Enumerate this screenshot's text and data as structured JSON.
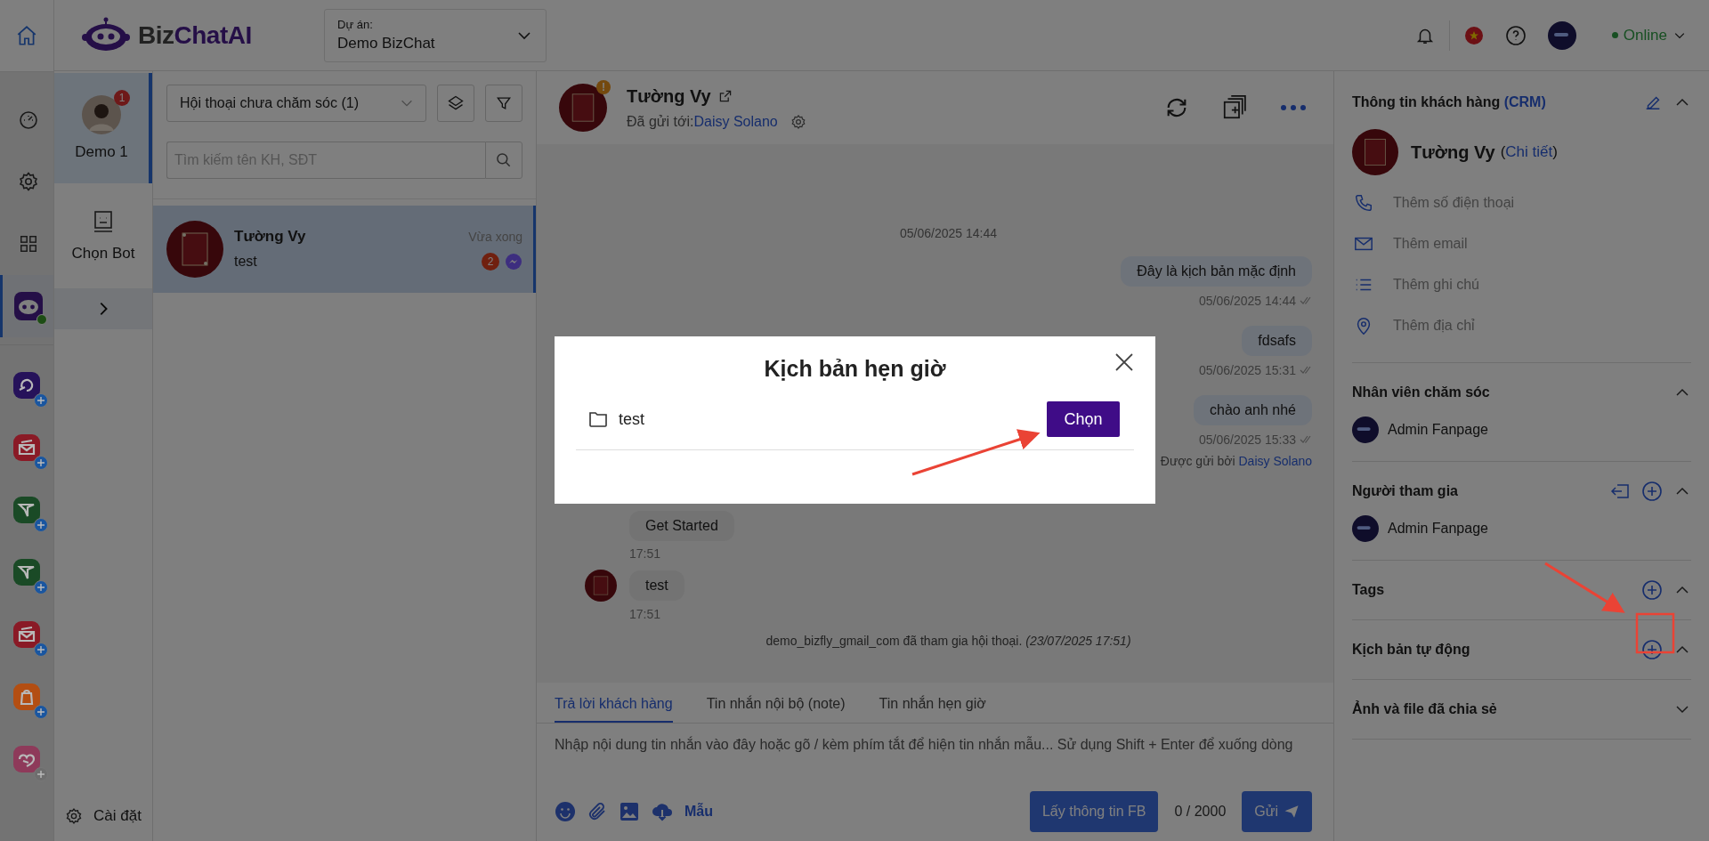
{
  "rail": {
    "home": {
      "selected": false
    },
    "nav": [
      {
        "kind": "dashboard",
        "selected": false
      },
      {
        "kind": "settings",
        "selected": false
      },
      {
        "kind": "apps",
        "selected": false
      },
      {
        "kind": "bot",
        "selected": true,
        "online": true
      }
    ],
    "channels": [
      {
        "kind": "loop",
        "color": "#26125a",
        "enabled": true
      },
      {
        "kind": "mail",
        "color": "#8a1a26",
        "enabled": true
      },
      {
        "kind": "plane",
        "color": "#1a4a26",
        "enabled": true
      },
      {
        "kind": "plane",
        "color": "#1a4a26",
        "enabled": true
      },
      {
        "kind": "mail",
        "color": "#8a1a26",
        "enabled": true
      },
      {
        "kind": "bag",
        "color": "#b34e12",
        "enabled": true
      },
      {
        "kind": "heart",
        "color": "#8e3a5a",
        "enabled": false
      }
    ]
  },
  "header": {
    "logo_left": "Biz",
    "logo_right": "ChatAI",
    "project": {
      "label": "Dự án:",
      "value": "Demo BizChat"
    },
    "status": {
      "label": "Online",
      "online": true
    }
  },
  "pages": {
    "items": [
      {
        "name": "Demo 1",
        "badge": "1",
        "selected": true
      }
    ],
    "bot_button": "Chọn Bot",
    "settings": "Cài đặt"
  },
  "conversations": {
    "filter": "Hội thoại chưa chăm sóc (1)",
    "search": {
      "placeholder": "Tìm kiếm tên KH, SĐT"
    },
    "items": [
      {
        "name": "Tường Vy",
        "last": "test",
        "time": "Vừa xong",
        "unread": "2",
        "selected": true
      }
    ]
  },
  "chat": {
    "name": "Tường Vy",
    "alert": "!",
    "sent_to_label": "Đã gửi tới:",
    "sent_to": "Daisy Solano",
    "messages": [
      {
        "kind": "date",
        "text": "05/06/2025 14:44"
      },
      {
        "kind": "outgoing",
        "text": "Đây là kịch bản mặc định",
        "time": "05/06/2025 14:44"
      },
      {
        "kind": "outgoing",
        "text": "fdsafs",
        "time": "05/06/2025 15:31"
      },
      {
        "kind": "outgoing",
        "text": "chào anh nhé",
        "time": "05/06/2025 15:33",
        "sender_label": "Được gửi bởi",
        "sender": "Daisy Solano"
      },
      {
        "kind": "incoming",
        "text": "Get Started",
        "time": "17:51",
        "avatar": false
      },
      {
        "kind": "incoming",
        "text": "test",
        "time": "17:51",
        "avatar": true
      },
      {
        "kind": "system",
        "text": "demo_bizfly_gmail_com đã tham gia hội thoại.",
        "note": "(23/07/2025 17:51)"
      }
    ],
    "composer": {
      "tabs": [
        {
          "label": "Trả lời khách hàng",
          "selected": true
        },
        {
          "label": "Tin nhắn nội bộ (note)",
          "selected": false
        },
        {
          "label": "Tin nhắn hẹn giờ",
          "selected": false
        }
      ],
      "placeholder": "Nhập nội dung tin nhắn vào đây hoặc gõ / kèm phím tắt để hiện tin nhắn mẫu... Sử dụng Shift + Enter để xuống dòng",
      "template": "Mẫu",
      "fb_button": "Lấy thông tin FB",
      "counter": "0 / 2000",
      "send": "Gửi"
    }
  },
  "crm": {
    "title": "Thông tin khách hàng",
    "title_link": "(CRM)",
    "name": "Tường Vy",
    "detail_prefix": "(",
    "detail_link": "Chi tiết",
    "detail_suffix": ")",
    "fields": [
      {
        "kind": "phone",
        "text": "Thêm số điện thoại"
      },
      {
        "kind": "email",
        "text": "Thêm email"
      },
      {
        "kind": "note",
        "text": "Thêm ghi chú"
      },
      {
        "kind": "address",
        "text": "Thêm địa chỉ"
      }
    ],
    "sections": [
      {
        "title": "Nhân viên chăm sóc",
        "expanded": true,
        "can_leave": false,
        "can_add": false,
        "members": [
          "Admin Fanpage"
        ],
        "highlighted": false
      },
      {
        "title": "Người tham gia",
        "expanded": true,
        "can_leave": true,
        "can_add": true,
        "members": [
          "Admin Fanpage"
        ],
        "highlighted": false
      },
      {
        "title": "Tags",
        "expanded": true,
        "can_leave": false,
        "can_add": true,
        "highlighted": false
      },
      {
        "title": "Kịch bản tự động",
        "expanded": true,
        "can_leave": false,
        "can_add": true,
        "highlighted": true
      },
      {
        "title": "Ảnh và file đã chia sẻ",
        "expanded": false,
        "can_leave": false,
        "can_add": false,
        "highlighted": false
      }
    ]
  },
  "modal": {
    "title": "Kịch bản hẹn giờ",
    "items": [
      {
        "name": "test",
        "button": "Chọn"
      }
    ]
  }
}
